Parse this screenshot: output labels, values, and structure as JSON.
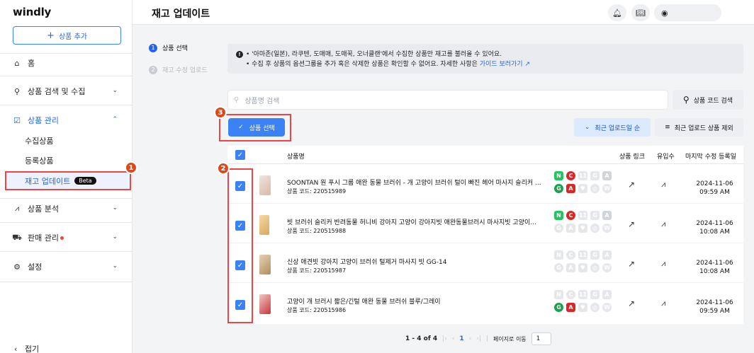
{
  "app": {
    "logo": "windly",
    "add_product": "상품 추가",
    "collapse": "접기"
  },
  "sidebar": {
    "home": "홈",
    "search_collect": "상품 검색 및 수집",
    "product_mgmt": "상품 관리",
    "sub": {
      "collected": "수집상품",
      "registered": "등록상품",
      "stock_update": "재고 업데이트",
      "beta": "Beta"
    },
    "analysis": "상품 분석",
    "sales_mgmt": "판매 관리",
    "settings": "설정"
  },
  "header": {
    "title": "재고 업데이트"
  },
  "steps": [
    {
      "num": "1",
      "label": "상품 선택"
    },
    {
      "num": "2",
      "label": "재고 수정 업로드"
    }
  ],
  "info": {
    "line1": "• '아마존(일본), 라쿠텐, 도매매, 도매꾹, 오너클랜'에서 수집한 상품만 재고를 불러올 수 있어요.",
    "line2": "• 수집 후 상품의 옵션그룹을 추가 혹은 삭제한 상품은 확인할 수 없어요. 자세한 사항은",
    "guide_link": "가이드 보러가기"
  },
  "search": {
    "placeholder": "상품명 검색",
    "code_search": "상품 코드 검색"
  },
  "actions": {
    "select": "상품 선택",
    "recent_upload": "최근 업로드일 순",
    "exclude_recent": "최근 업로드 상품 제외"
  },
  "callouts": {
    "c1": "1",
    "c2": "2",
    "c3": "3"
  },
  "table": {
    "headers": {
      "name": "상품명",
      "link": "상품 링크",
      "inflow": "유입수",
      "last_modified": "마지막 수정 등록일"
    },
    "rows": [
      {
        "name": "SOONTAN 원 푸시 그룹 애완 동물 브러쉬 - 개 고양이 브러쉬 털이 빠진 헤어 마사지 슬리커 ...",
        "code": "상품 코드: 220515989",
        "date1": "2024-11-06",
        "date2": "09:59 AM"
      },
      {
        "name": "빗 브러쉬 슬리커 반려동물 허니비 강아지 고양이 강아지빗 애완동물브러시 마사지빗 고양이...",
        "code": "상품 코드: 220515988",
        "date1": "2024-11-06",
        "date2": "10:08 AM"
      },
      {
        "name": "신상 애견빗 강아지 고양이 브러쉬 털제거 마사지 빗 GG-14",
        "code": "상품 코드: 220515987",
        "date1": "2024-11-06",
        "date2": "10:08 AM"
      },
      {
        "name": "고양이 개 브러시 짧은/긴털 애완 동물 브러쉬 블루/그레이",
        "code": "상품 코드: 220515986",
        "date1": "2024-11-06",
        "date2": "09:59 AM"
      }
    ]
  },
  "markets": {
    "top": [
      "N",
      "C",
      "11",
      "G",
      "A"
    ],
    "bottom": [
      "G",
      "A",
      "♥",
      "◎",
      "W"
    ]
  },
  "pagination": {
    "range": "1 - 4 of 4",
    "current": "1",
    "goto_label": "페이지로 이동",
    "goto_value": "1"
  }
}
